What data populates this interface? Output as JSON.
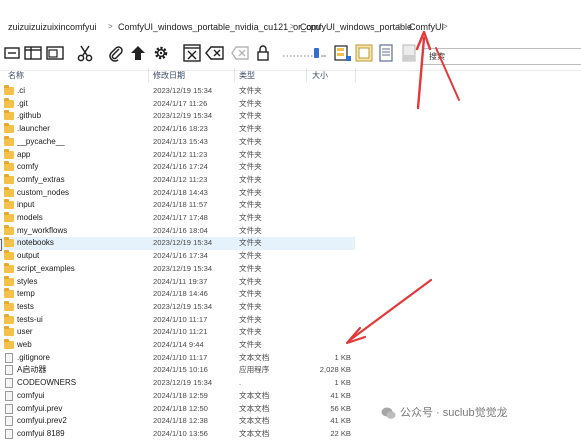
{
  "breadcrumb": {
    "items": [
      "zuizuizuizuixincomfyui",
      "ComfyUI_windows_portable_nvidia_cu121_or_cpu",
      "ComfyUI_windows_portable",
      "ComfyUI"
    ],
    "separator": ">"
  },
  "toolbar": {
    "search_placeholder": "搜索"
  },
  "columns": {
    "name": "名称",
    "modified": "修改日期",
    "type": "类型",
    "size": "大小"
  },
  "files": [
    {
      "name": ".ci",
      "date": "2023/12/19 15:34",
      "type": "文件夹",
      "size": "",
      "kind": "folder"
    },
    {
      "name": ".git",
      "date": "2024/1/17 11:26",
      "type": "文件夹",
      "size": "",
      "kind": "folder"
    },
    {
      "name": ".github",
      "date": "2023/12/19 15:34",
      "type": "文件夹",
      "size": "",
      "kind": "folder"
    },
    {
      "name": ".launcher",
      "date": "2024/1/16 18:23",
      "type": "文件夹",
      "size": "",
      "kind": "folder"
    },
    {
      "name": "__pycache__",
      "date": "2024/1/13 15:43",
      "type": "文件夹",
      "size": "",
      "kind": "folder"
    },
    {
      "name": "app",
      "date": "2024/1/12 11:23",
      "type": "文件夹",
      "size": "",
      "kind": "folder"
    },
    {
      "name": "comfy",
      "date": "2024/1/16 17:24",
      "type": "文件夹",
      "size": "",
      "kind": "folder"
    },
    {
      "name": "comfy_extras",
      "date": "2024/1/12 11:23",
      "type": "文件夹",
      "size": "",
      "kind": "folder"
    },
    {
      "name": "custom_nodes",
      "date": "2024/1/18 14:43",
      "type": "文件夹",
      "size": "",
      "kind": "folder"
    },
    {
      "name": "input",
      "date": "2024/1/18 11:57",
      "type": "文件夹",
      "size": "",
      "kind": "folder"
    },
    {
      "name": "models",
      "date": "2024/1/17 17:48",
      "type": "文件夹",
      "size": "",
      "kind": "folder"
    },
    {
      "name": "my_workflows",
      "date": "2024/1/16 18:04",
      "type": "文件夹",
      "size": "",
      "kind": "folder"
    },
    {
      "name": "notebooks",
      "date": "2023/12/19 15:34",
      "type": "文件夹",
      "size": "",
      "kind": "folder"
    },
    {
      "name": "output",
      "date": "2024/1/16 17:34",
      "type": "文件夹",
      "size": "",
      "kind": "folder"
    },
    {
      "name": "script_examples",
      "date": "2023/12/19 15:34",
      "type": "文件夹",
      "size": "",
      "kind": "folder"
    },
    {
      "name": "styles",
      "date": "2024/1/11 19:37",
      "type": "文件夹",
      "size": "",
      "kind": "folder"
    },
    {
      "name": "temp",
      "date": "2024/1/18 14:46",
      "type": "文件夹",
      "size": "",
      "kind": "folder"
    },
    {
      "name": "tests",
      "date": "2023/12/19 15:34",
      "type": "文件夹",
      "size": "",
      "kind": "folder"
    },
    {
      "name": "tests-ui",
      "date": "2024/1/10 11:17",
      "type": "文件夹",
      "size": "",
      "kind": "folder"
    },
    {
      "name": "user",
      "date": "2024/1/10 11:21",
      "type": "文件夹",
      "size": "",
      "kind": "folder"
    },
    {
      "name": "web",
      "date": "2024/1/14 9:44",
      "type": "文件夹",
      "size": "",
      "kind": "folder"
    },
    {
      "name": ".gitignore",
      "date": "2024/1/10 11:17",
      "type": "文本文档",
      "size": "1 KB",
      "kind": "file"
    },
    {
      "name": "A启动器",
      "date": "2024/1/15 10:16",
      "type": "应用程序",
      "size": "2,028 KB",
      "kind": "file"
    },
    {
      "name": "CODEOWNERS",
      "date": "2023/12/19 15:34",
      "type": ".",
      "size": "1 KB",
      "kind": "file"
    },
    {
      "name": "comfyui",
      "date": "2024/1/18 12:59",
      "type": "文本文档",
      "size": "41 KB",
      "kind": "file"
    },
    {
      "name": "comfyui.prev",
      "date": "2024/1/18 12:50",
      "type": "文本文档",
      "size": "56 KB",
      "kind": "file"
    },
    {
      "name": "comfyui.prev2",
      "date": "2024/1/18 12:38",
      "type": "文本文档",
      "size": "41 KB",
      "kind": "file"
    },
    {
      "name": "comfyui 8189",
      "date": "2024/1/10 13:56",
      "type": "文本文档",
      "size": "22 KB",
      "kind": "file"
    }
  ],
  "selected_row": "notebooks",
  "watermark": "公众号 · suclub觉觉龙",
  "colors": {
    "annotation_arrow": "#e23a3a",
    "selection": "#e5f1fb",
    "folder": "#f4c24b"
  }
}
